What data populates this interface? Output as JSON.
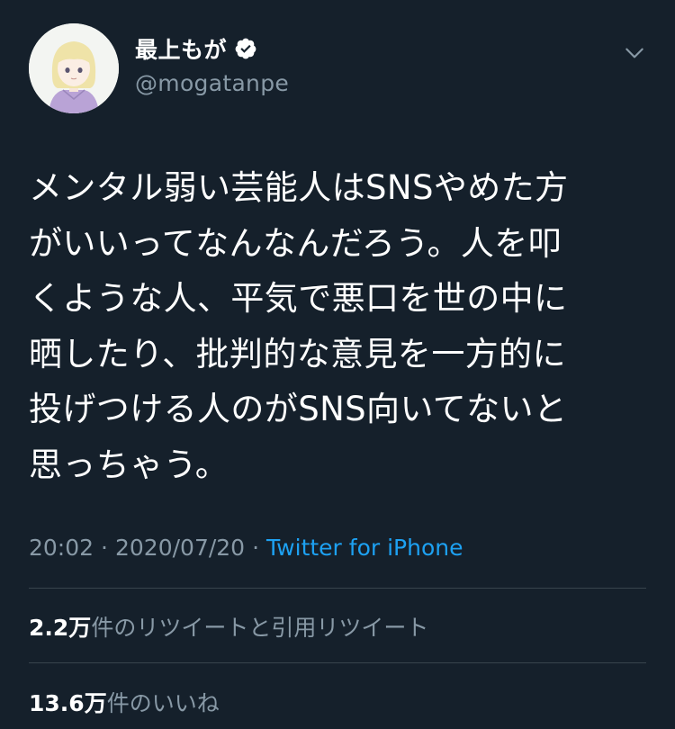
{
  "user": {
    "display_name": "最上もが",
    "handle": "@mogatanpe",
    "verified": true,
    "avatar": "avatar-illustration"
  },
  "tweet": {
    "text": "メンタル弱い芸能人はSNSやめた方\nがいいってなんなんだろう。人を叩\nくような人、平気で悪口を世の中に\n晒したり、批判的な意見を一方的に\n投げつける人のがSNS向いてないと\n思っちゃう。",
    "time": "20:02",
    "separator": "·",
    "date": "2020/07/20",
    "source": "Twitter for iPhone"
  },
  "stats": {
    "retweets": {
      "count": "2.2",
      "unit": "万",
      "label": "件のリツイートと引用リツイート"
    },
    "likes": {
      "count": "13.6",
      "unit": "万",
      "label": "件のいいね"
    }
  },
  "colors": {
    "background": "#15202b",
    "text": "#ffffff",
    "secondary_text": "#8899a6",
    "accent": "#1da1f2",
    "divider": "#38444d"
  },
  "icons": {
    "verified": "verified-badge-icon",
    "menu": "chevron-down-icon"
  }
}
